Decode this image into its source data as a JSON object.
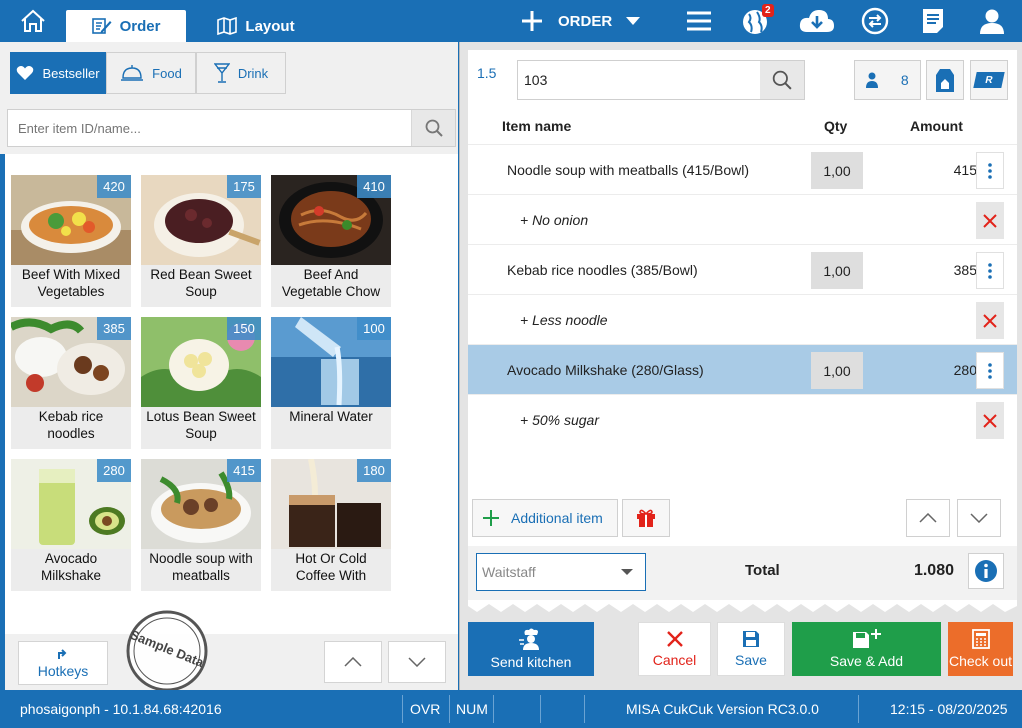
{
  "topbar": {
    "tabs": [
      {
        "label": "Order",
        "icon": "pencil-icon"
      },
      {
        "label": "Layout",
        "icon": "map-icon"
      }
    ],
    "order_label": "ORDER",
    "notification_count": "2"
  },
  "categories": [
    {
      "label": "Bestseller",
      "icon": "heart-icon"
    },
    {
      "label": "Food",
      "icon": "cloche-icon"
    },
    {
      "label": "Drink",
      "icon": "cocktail-icon"
    }
  ],
  "search": {
    "placeholder": "Enter item ID/name..."
  },
  "menu_items": [
    {
      "name_1": "Beef With Mixed",
      "name_2": "Vegetables",
      "price": "420"
    },
    {
      "name_1": "Red Bean Sweet",
      "name_2": "Soup",
      "price": "175"
    },
    {
      "name_1": "Beef And",
      "name_2": "Vegetable Chow",
      "price": "410"
    },
    {
      "name_1": "Kebab rice",
      "name_2": "noodles",
      "price": "385"
    },
    {
      "name_1": "Lotus Bean Sweet",
      "name_2": "Soup",
      "price": "150"
    },
    {
      "name_1": "Mineral Water",
      "name_2": "",
      "price": "100"
    },
    {
      "name_1": "Avocado",
      "name_2": "Milkshake",
      "price": "280"
    },
    {
      "name_1": "Noodle soup with",
      "name_2": "meatballs",
      "price": "415"
    },
    {
      "name_1": "Hot Or Cold",
      "name_2": "Coffee With",
      "price": "180"
    }
  ],
  "watermark": "Sample Data",
  "hotkeys_label": "Hotkeys",
  "order": {
    "table": "1.5",
    "order_no": "103",
    "guests": "8",
    "badge_r": "R",
    "columns": {
      "name": "Item name",
      "qty": "Qty",
      "amount": "Amount"
    },
    "lines": [
      {
        "name": "Noodle soup with meatballs (415/Bowl)",
        "qty": "1,00",
        "amount": "415",
        "note": "+ No onion",
        "selected": false
      },
      {
        "name": "Kebab rice noodles (385/Bowl)",
        "qty": "1,00",
        "amount": "385",
        "note": "+ Less noodle",
        "selected": false
      },
      {
        "name": "Avocado Milkshake (280/Glass)",
        "qty": "1,00",
        "amount": "280",
        "note": "+ 50% sugar",
        "selected": true
      }
    ],
    "additional_item": "Additional item",
    "waitstaff_placeholder": "Waitstaff",
    "total_label": "Total",
    "total_value": "1.080"
  },
  "actions": {
    "send_kitchen": "Send kitchen",
    "cancel": "Cancel",
    "save": "Save",
    "save_add": "Save & Add",
    "checkout": "Check out"
  },
  "status": {
    "host": "phosaigonph - 10.1.84.68:42016",
    "ovr": "OVR",
    "num": "NUM",
    "version": "MISA CukCuk Version RC3.0.0",
    "datetime": "12:15 - 08/20/2025"
  },
  "colors": {
    "brand": "#1a6fb5",
    "green": "#1f9e4a",
    "orange": "#ec6d2a",
    "red": "#e2231a",
    "selected": "#a9cbe6"
  }
}
